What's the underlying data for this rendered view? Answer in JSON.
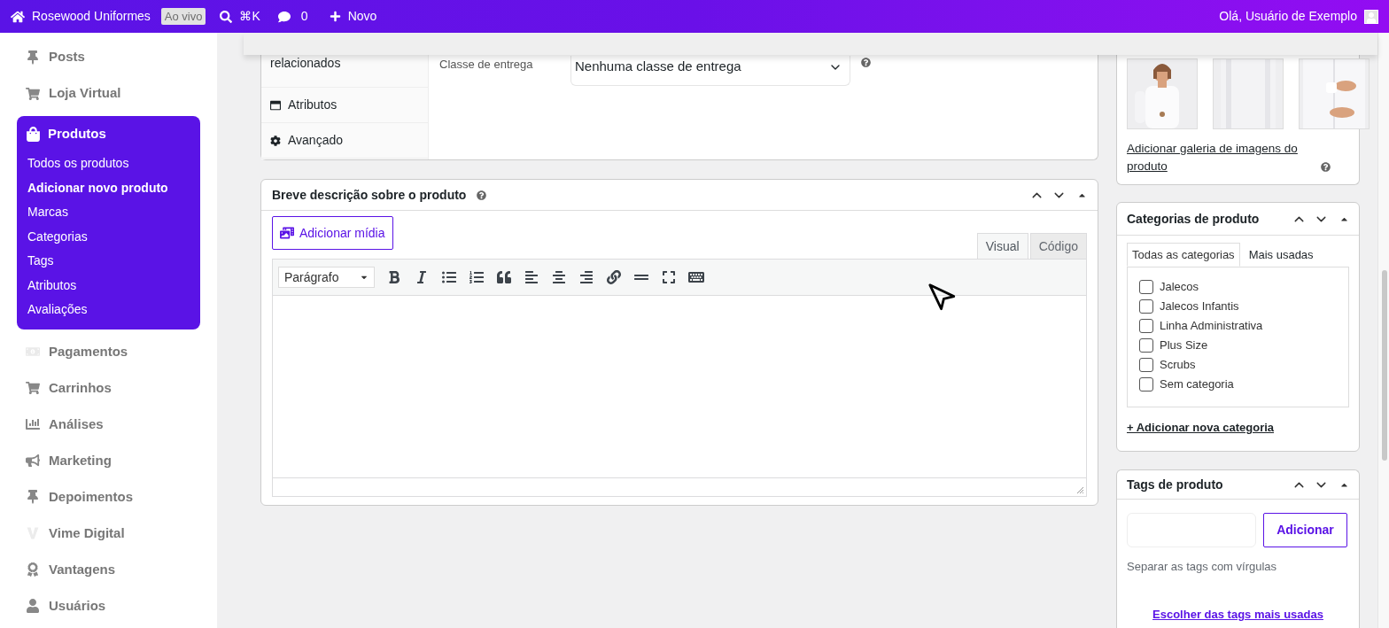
{
  "topbar": {
    "site_name": "Rosewood Uniformes",
    "live_badge": "Ao vivo",
    "search_shortcut": "⌘K",
    "comments_count": "0",
    "new_label": "Novo",
    "greeting": "Olá, Usuário de Exemplo"
  },
  "sidebar": {
    "items": [
      {
        "label": "Posts",
        "selected": false
      },
      {
        "label": "Loja Virtual",
        "selected": false
      },
      {
        "label": "Produtos",
        "selected": true,
        "children": [
          {
            "label": "Todos os produtos",
            "selected": false
          },
          {
            "label": "Adicionar novo produto",
            "selected": true
          },
          {
            "label": "Marcas",
            "selected": false
          },
          {
            "label": "Categorias",
            "selected": false
          },
          {
            "label": "Tags",
            "selected": false
          },
          {
            "label": "Atributos",
            "selected": false
          },
          {
            "label": "Avaliações",
            "selected": false
          }
        ]
      },
      {
        "label": "Pagamentos",
        "selected": false
      },
      {
        "label": "Carrinhos",
        "selected": false
      },
      {
        "label": "Análises",
        "selected": false
      },
      {
        "label": "Marketing",
        "selected": false
      },
      {
        "label": "Depoimentos",
        "selected": false
      },
      {
        "label": "Vime Digital",
        "selected": false
      },
      {
        "label": "Vantagens",
        "selected": false
      },
      {
        "label": "Usuários",
        "selected": false
      }
    ]
  },
  "product_data": {
    "tabs": [
      {
        "label": "relacionados",
        "selected": false
      },
      {
        "label": "Atributos",
        "selected": false
      },
      {
        "label": "Avançado",
        "selected": false
      }
    ],
    "shipping_class": {
      "label": "Classe de entrega",
      "value": "Nenhuma classe de entrega"
    }
  },
  "short_description": {
    "title": "Breve descrição sobre o produto",
    "add_media": "Adicionar mídia",
    "editor_tabs": [
      {
        "label": "Visual",
        "selected": true
      },
      {
        "label": "Código",
        "selected": false
      }
    ],
    "format": "Parágrafo"
  },
  "gallery": {
    "link": "Adicionar galeria de imagens do produto"
  },
  "categories": {
    "title": "Categorias de produto",
    "tabs": [
      {
        "label": "Todas as categorias",
        "selected": true
      },
      {
        "label": "Mais usadas",
        "selected": false
      }
    ],
    "items": [
      {
        "label": "Jalecos",
        "checked": false
      },
      {
        "label": "Jalecos Infantis",
        "checked": false
      },
      {
        "label": "Linha Administrativa",
        "checked": false
      },
      {
        "label": "Plus Size",
        "checked": false
      },
      {
        "label": "Scrubs",
        "checked": false
      },
      {
        "label": "Sem categoria",
        "checked": false
      }
    ],
    "add_link": "+ Adicionar nova categoria"
  },
  "tags": {
    "title": "Tags de produto",
    "button": "Adicionar",
    "hint": "Separar as tags com vírgulas",
    "link": "Escolher das tags mais usadas"
  }
}
